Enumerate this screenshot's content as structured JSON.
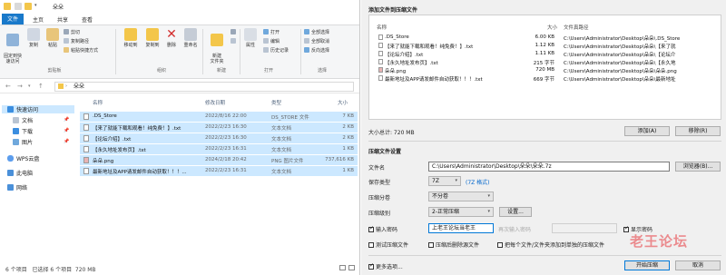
{
  "explorer": {
    "title": "朵朵",
    "tabs": [
      "文件",
      "主页",
      "共享",
      "查看"
    ],
    "ribbon": {
      "pin_label": "固定到快\n速访问",
      "copy_label": "复制",
      "paste_label": "粘贴",
      "cut_label": "剪切",
      "copy_path_label": "复制路径",
      "paste_shortcut_label": "粘贴快捷方式",
      "clipboard_group": "剪贴板",
      "move_to_label": "移动到",
      "copy_to_label": "复制到",
      "delete_label": "删除",
      "rename_label": "重命名",
      "organize_group": "组织",
      "new_folder_label": "新建\n文件夹",
      "new_group": "新建",
      "properties_label": "属性",
      "open_label": "打开",
      "edit_label": "编辑",
      "history_label": "历史记录",
      "open_group": "打开",
      "select_all_label": "全部选择",
      "select_none_label": "全部取消",
      "invert_label": "反向选择",
      "select_group": "选择"
    },
    "address": "朵朵",
    "nav": {
      "quick_access": "快速访问",
      "items": [
        "文档",
        "下载",
        "图片"
      ],
      "wps": "WPS云盘",
      "pc": "此电脑",
      "network": "网络"
    },
    "columns": {
      "name": "名称",
      "date": "修改日期",
      "type": "类型",
      "size": "大小"
    },
    "files": [
      {
        "name": ".DS_Store",
        "date": "2022/8/16 22:00",
        "type": "DS_STORE 文件",
        "size": "7 KB"
      },
      {
        "name": "【来了就能下载和观看！纯免费！】.txt",
        "date": "2022/2/23 16:30",
        "type": "文本文档",
        "size": "2 KB"
      },
      {
        "name": "【论坛介绍】.txt",
        "date": "2022/2/23 16:30",
        "type": "文本文档",
        "size": "2 KB"
      },
      {
        "name": "【永久地址发布页】.txt",
        "date": "2022/2/23 16:31",
        "type": "文本文档",
        "size": "1 KB"
      },
      {
        "name": "朵朵.png",
        "date": "2024/2/18 20:42",
        "type": "PNG 图片文件",
        "size": "737,616 KB"
      },
      {
        "name": "最新地址及APP请发邮件自动获取！！！...",
        "date": "2022/2/23 16:31",
        "type": "文本文档",
        "size": "1 KB"
      }
    ],
    "status": "6 个项目   已选择 6 个项目  720 MB"
  },
  "dialog": {
    "add_section": "添加文件到压缩文件",
    "headers": {
      "name": "名称",
      "size": "大小",
      "path": "文件真路径"
    },
    "zfiles": [
      {
        "name": ".DS_Store",
        "size": "6.00 KB",
        "path": "C:\\Users\\Administrator\\Desktop\\朵朵\\.DS_Store"
      },
      {
        "name": "【来了就能下载和观看！纯免费！】.txt",
        "size": "1.12 KB",
        "path": "C:\\Users\\Administrator\\Desktop\\朵朵\\【来了就"
      },
      {
        "name": "【论坛介绍】.txt",
        "size": "1.11 KB",
        "path": "C:\\Users\\Administrator\\Desktop\\朵朵\\【论坛介"
      },
      {
        "name": "【永久地址发布页】.txt",
        "size": "215 字节",
        "path": "C:\\Users\\Administrator\\Desktop\\朵朵\\【永久地"
      },
      {
        "name": "朵朵.png",
        "size": "720 MB",
        "path": "C:\\Users\\Administrator\\Desktop\\朵朵\\朵朵.png"
      },
      {
        "name": "最新地址及APP请发邮件自动获取！！！.txt",
        "size": "669 字节",
        "path": "C:\\Users\\Administrator\\Desktop\\朵朵\\最新地址"
      }
    ],
    "add_btn": "添加(A)",
    "remove_btn": "移除(R)",
    "total": "大小总计: 720 MB",
    "settings_section": "压缩文件设置",
    "filename_label": "文件名",
    "filename_value": "C:\\Users\\Administrator\\Desktop\\朵朵\\朵朵.7z",
    "browse_btn": "浏览器(B)...",
    "type_label": "保存类型",
    "type_value": "7Z",
    "type_link": "(7Z 格式)",
    "split_label": "压缩分卷",
    "split_value": "不分卷",
    "level_label": "压缩级别",
    "level_value": "2-正常压缩",
    "options_btn": "设置...",
    "password_cb": "输入密码",
    "password_value": "上老王论坛当老王",
    "repeat_label": "再次输入密码",
    "show_pw_cb": "显示密码",
    "test_cb": "测试压缩文件",
    "delete_cb": "压缩后删除源文件",
    "separate_cb": "把每个文件/文件夹添加到单独的压缩文件",
    "more_cb": "更多选项...",
    "ok_btn": "开始压缩",
    "cancel_btn": "取消"
  },
  "watermark": "老王论坛",
  "colors": {
    "accent": "#1979ca",
    "selection": "#cce8ff",
    "watermark": "#e8383d"
  }
}
